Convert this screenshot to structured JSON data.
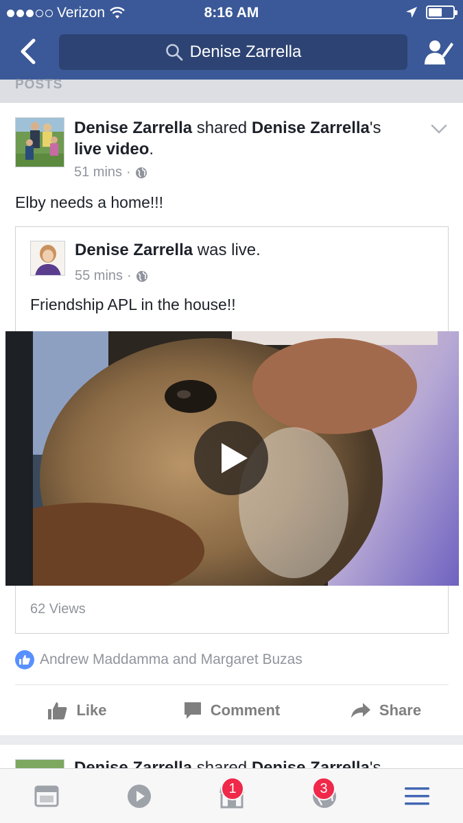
{
  "status_bar": {
    "carrier": "Verizon",
    "time": "8:16 AM",
    "battery_level": 0.55
  },
  "header": {
    "search_text": "Denise Zarrella",
    "icons": {
      "back": "back-chevron-icon",
      "search": "search-icon",
      "profile": "profile-edit-icon"
    },
    "color": "#3b5998"
  },
  "section": {
    "label": "POSTS"
  },
  "post": {
    "author": "Denise Zarrella",
    "verb": " shared ",
    "shared_owner": "Denise Zarrella",
    "possessive": "'s",
    "object": "live video",
    "period": ".",
    "time": "51 mins",
    "separator": "·",
    "text": "Elby needs a home!!!",
    "shared": {
      "author": "Denise Zarrella",
      "status": " was live.",
      "time": "55 mins",
      "separator": "·",
      "text": "Friendship APL in the house!!",
      "views": "62 Views"
    },
    "reactions": "Andrew Maddamma and Margaret Buzas",
    "actions": {
      "like": "Like",
      "comment": "Comment",
      "share": "Share"
    }
  },
  "next_post": {
    "author": "Denise Zarrella",
    "verb": " shared ",
    "shared_owner": "Denise Zarrella",
    "possessive": "'s"
  },
  "tabbar": {
    "items": [
      {
        "icon": "news-feed-icon"
      },
      {
        "icon": "video-icon"
      },
      {
        "icon": "marketplace-icon",
        "badge": "1"
      },
      {
        "icon": "notifications-globe-icon",
        "badge": "3"
      },
      {
        "icon": "menu-icon"
      }
    ],
    "accent": "#4267b2"
  }
}
